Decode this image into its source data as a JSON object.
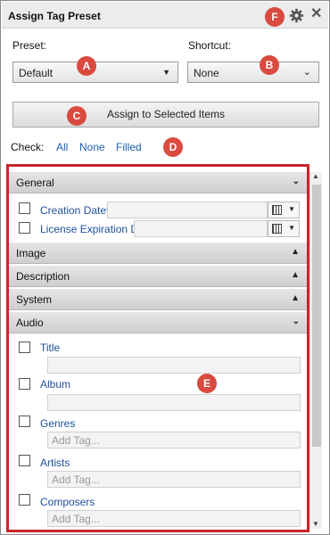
{
  "window": {
    "title": "Assign Tag Preset",
    "gear_icon": "gear-icon",
    "close_label": "✕"
  },
  "preset": {
    "label": "Preset:",
    "value": "Default"
  },
  "shortcut": {
    "label": "Shortcut:",
    "value": "None"
  },
  "assign_button": "Assign to Selected Items",
  "check": {
    "label": "Check:",
    "all": "All",
    "none": "None",
    "filled": "Filled"
  },
  "sections": {
    "general": "General",
    "image": "Image",
    "description": "Description",
    "system": "System",
    "audio": "Audio"
  },
  "general_fields": {
    "creation_date": "Creation Datet",
    "license_expiration": "License Expiration D"
  },
  "audio_fields": {
    "title": "Title",
    "album": "Album",
    "genres": "Genres",
    "artists": "Artists",
    "composers": "Composers",
    "add_tag_placeholder": "Add Tag..."
  },
  "badges": {
    "a": "A",
    "b": "B",
    "c": "C",
    "d": "D",
    "e": "E",
    "f": "F"
  },
  "colors": {
    "badge": "#d94a3f",
    "highlight_frame": "#c9252b",
    "link": "#1f5fb4"
  }
}
